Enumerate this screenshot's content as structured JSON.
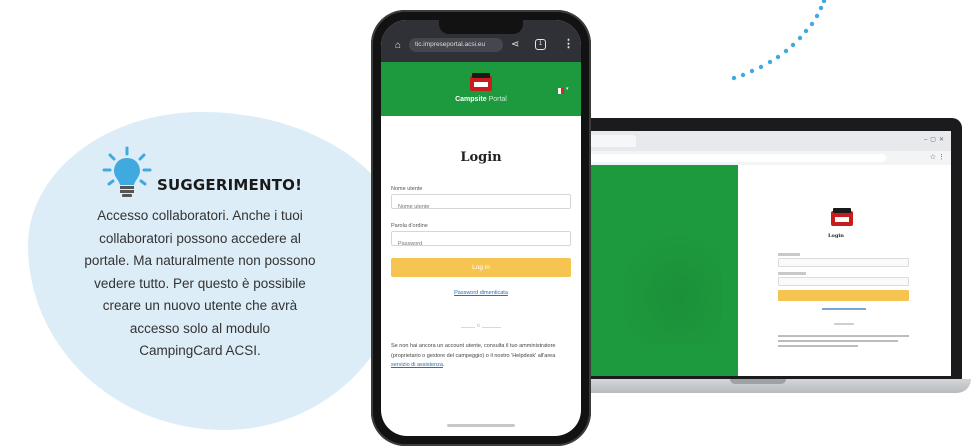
{
  "tip": {
    "heading": "SUGGERIMENTO!",
    "lines": [
      "Accesso collaboratori. Anche i tuoi",
      "collaboratori possono accedere al",
      "portale. Ma naturalmente non possono",
      "vedere tutto. Per questo è possibile",
      "creare un nuovo utente che avrà",
      "accesso solo al modulo",
      "CampingCard ACSI."
    ],
    "icon": "lightbulb-icon"
  },
  "phone": {
    "browser": {
      "url": "tic.impreseportal.acsi.eu",
      "tab_count": "1"
    },
    "header": {
      "app_name": "Campsite",
      "app_name_suffix": "Portal"
    },
    "login": {
      "title": "Login",
      "username_label": "Nome utente",
      "username_placeholder": "Nome utente",
      "password_label": "Parola d'ordine",
      "password_placeholder": "Password",
      "button_label": "Log in",
      "forgot_link": "Password dimenticata",
      "separator": "o",
      "help_text": "Se non hai ancora un account utente, consulta il tuo amministratore (proprietario o gestore del campeggio) o il nostro 'Helpdesk' all'area ",
      "help_link": "servizio di assistenza",
      "help_text_end": "."
    }
  },
  "colors": {
    "brand_green": "#1e9a3e",
    "button_yellow": "#f6c451",
    "tip_background": "#dcedf8",
    "dots_blue": "#3fa9e0"
  }
}
